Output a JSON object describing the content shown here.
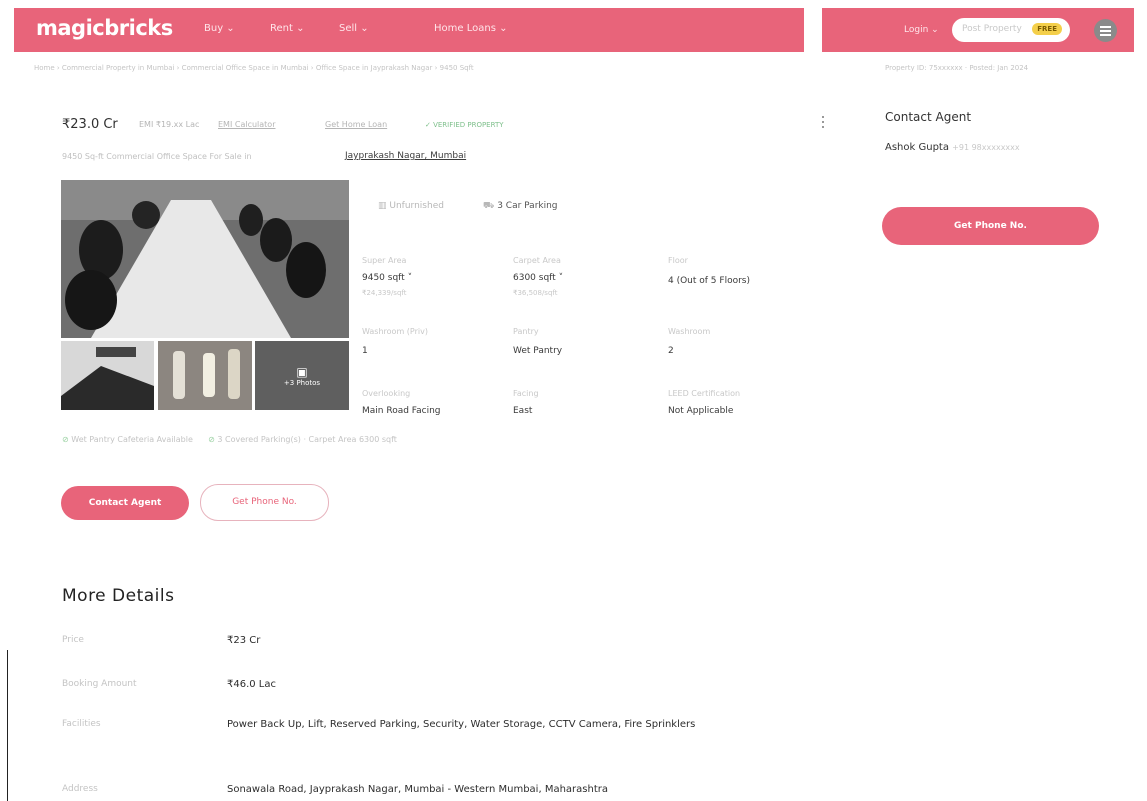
{
  "header": {
    "logo": "magicbricks",
    "nav": [
      "Buy ⌄",
      "Rent ⌄",
      "Sell ⌄",
      "Home Loans ⌄"
    ],
    "login": "Login ⌄",
    "post_property": "Post Property",
    "free_badge": "FREE"
  },
  "breadcrumb": {
    "left": "Home › Commercial Property in Mumbai › Commercial Office Space in Mumbai › Office Space in Jayprakash Nagar › 9450 Sqft",
    "right": "Property ID: 75xxxxxx · Posted: Jan 2024"
  },
  "listing": {
    "price": "₹23.0 Cr",
    "emi_text": "EMI ₹19.xx Lac",
    "emi_link": "EMI Calculator",
    "loan_link": "Get Home Loan",
    "verified": "✓ VERIFIED PROPERTY",
    "subtitle": "9450 Sq-ft Commercial Office Space For Sale in",
    "locality": "Jayprakash Nagar, Mumbai",
    "photos_more": "+3 Photos",
    "furnishing": "Unfurnished",
    "parking": "3 Car Parking"
  },
  "specs": [
    {
      "label": "Super Area",
      "value": "9450 sqft ˅",
      "sub": "₹24,339/sqft"
    },
    {
      "label": "Carpet Area",
      "value": "6300 sqft ˅",
      "sub": "₹36,508/sqft"
    },
    {
      "label": "Floor",
      "value": "4 (Out of 5 Floors)",
      "sub": ""
    },
    {
      "label": "Washroom (Priv)",
      "value": "1",
      "sub": ""
    },
    {
      "label": "Pantry",
      "value": "Wet Pantry",
      "sub": ""
    },
    {
      "label": "Washroom",
      "value": "2",
      "sub": ""
    },
    {
      "label": "Overlooking",
      "value": "Main Road Facing",
      "sub": ""
    },
    {
      "label": "Facing",
      "value": "East",
      "sub": ""
    },
    {
      "label": "LEED Certification",
      "value": "Not Applicable",
      "sub": ""
    }
  ],
  "features": {
    "one": "Wet Pantry Cafeteria Available",
    "two": "3 Covered Parking(s) · Carpet Area 6300 sqft"
  },
  "actions": {
    "contact": "Contact Agent",
    "phone": "Get Phone No."
  },
  "sidebar": {
    "title": "Contact Agent",
    "agent_name": "Ashok Gupta",
    "agent_phone": "+91 98xxxxxxxx",
    "phone_button": "Get Phone No."
  },
  "more_details": {
    "title": "More Details",
    "rows": [
      {
        "label": "Price",
        "value": "₹23 Cr"
      },
      {
        "label": "Booking Amount",
        "value": "₹46.0 Lac"
      },
      {
        "label": "Facilities",
        "value": "Power Back Up, Lift, Reserved Parking, Security, Water Storage, CCTV Camera, Fire Sprinklers"
      },
      {
        "label": "Address",
        "value": "Sonawala Road, Jayprakash Nagar, Mumbai - Western Mumbai, Maharashtra"
      }
    ]
  },
  "colors": {
    "brand": "#e8647a",
    "free_badge": "#f4cf4a",
    "verified": "#7fc08c"
  }
}
